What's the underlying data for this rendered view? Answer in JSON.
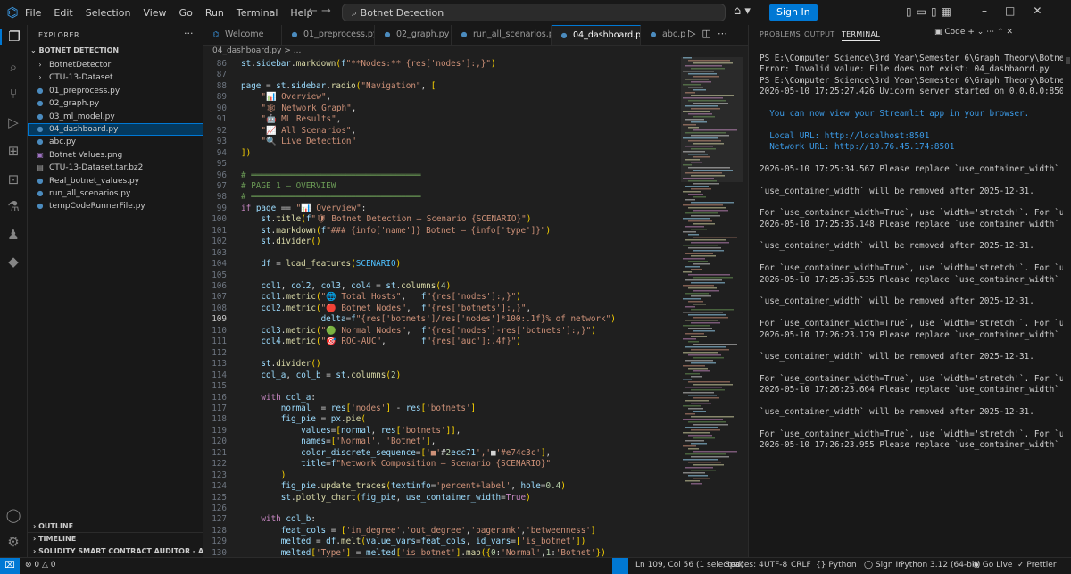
{
  "menu": [
    "File",
    "Edit",
    "Selection",
    "View",
    "Go",
    "Run",
    "Terminal",
    "Help"
  ],
  "titlebar": {
    "search_text": "Botnet Detection",
    "signin_label": "Sign In"
  },
  "sidebar": {
    "header": "EXPLORER",
    "project": "BOTNET DETECTION",
    "files": [
      {
        "name": "BotnetDetector",
        "icon": "folder-icon",
        "glyph": "›",
        "color": "#cccccc"
      },
      {
        "name": "CTU-13-Dataset",
        "icon": "folder-icon",
        "glyph": "›",
        "color": "#cccccc"
      },
      {
        "name": "01_preprocess.py",
        "icon": "python-file-icon",
        "glyph": "●",
        "color": "#4b8bbe"
      },
      {
        "name": "02_graph.py",
        "icon": "python-file-icon",
        "glyph": "●",
        "color": "#4b8bbe"
      },
      {
        "name": "03_ml_model.py",
        "icon": "python-file-icon",
        "glyph": "●",
        "color": "#4b8bbe"
      },
      {
        "name": "04_dashboard.py",
        "icon": "python-file-icon",
        "glyph": "●",
        "color": "#4b8bbe"
      },
      {
        "name": "abc.py",
        "icon": "python-file-icon",
        "glyph": "●",
        "color": "#4b8bbe"
      },
      {
        "name": "Botnet Values.png",
        "icon": "image-file-icon",
        "glyph": "▣",
        "color": "#a074c4"
      },
      {
        "name": "CTU-13-Dataset.tar.bz2",
        "icon": "archive-file-icon",
        "glyph": "▤",
        "color": "#a0a0a0"
      },
      {
        "name": "Real_botnet_values.py",
        "icon": "python-file-icon",
        "glyph": "●",
        "color": "#4b8bbe"
      },
      {
        "name": "run_all_scenarios.py",
        "icon": "python-file-icon",
        "glyph": "●",
        "color": "#4b8bbe"
      },
      {
        "name": "tempCodeRunnerFile.py",
        "icon": "python-file-icon",
        "glyph": "●",
        "color": "#4b8bbe"
      }
    ],
    "bottom": [
      "OUTLINE",
      "TIMELINE",
      "SOLIDITY SMART CONTRACT AUDITOR - ARMUR AI"
    ]
  },
  "editor": {
    "tabs": [
      "Welcome",
      "01_preprocess.py",
      "02_graph.py",
      "run_all_scenarios.py",
      "04_dashboard.py",
      "abc.py"
    ],
    "breadcrumb": "04_dashboard.py > ...",
    "lines": [
      {
        "n": "86",
        "t": "st.sidebar.markdown(f\"**Nodes:** {res['nodes']:,}\")"
      },
      {
        "n": "87",
        "t": ""
      },
      {
        "n": "88",
        "t": "page = st.sidebar.radio(\"Navigation\", ["
      },
      {
        "n": "89",
        "t": "    \"📊 Overview\","
      },
      {
        "n": "90",
        "t": "    \"🕸 Network Graph\","
      },
      {
        "n": "91",
        "t": "    \"🤖 ML Results\","
      },
      {
        "n": "92",
        "t": "    \"📈 All Scenarios\","
      },
      {
        "n": "93",
        "t": "    \"🔍 Live Detection\""
      },
      {
        "n": "94",
        "t": "])"
      },
      {
        "n": "95",
        "t": ""
      },
      {
        "n": "96",
        "t": "# ══════════════════════════════════"
      },
      {
        "n": "97",
        "t": "# PAGE 1 — OVERVIEW"
      },
      {
        "n": "98",
        "t": "# ══════════════════════════════════"
      },
      {
        "n": "99",
        "t": "if page == \"📊 Overview\":"
      },
      {
        "n": "100",
        "t": "    st.title(f\"🛡 Botnet Detection — Scenario {SCENARIO}\")"
      },
      {
        "n": "101",
        "t": "    st.markdown(f\"### {info['name']} Botnet — {info['type']}\")"
      },
      {
        "n": "102",
        "t": "    st.divider()"
      },
      {
        "n": "103",
        "t": ""
      },
      {
        "n": "104",
        "t": "    df = load_features(SCENARIO)"
      },
      {
        "n": "105",
        "t": ""
      },
      {
        "n": "106",
        "t": "    col1, col2, col3, col4 = st.columns(4)"
      },
      {
        "n": "107",
        "t": "    col1.metric(\"🌐 Total Hosts\",   f\"{res['nodes']:,}\")"
      },
      {
        "n": "108",
        "t": "    col2.metric(\"🔴 Botnet Nodes\",  f\"{res['botnets']:,}\","
      },
      {
        "n": "109",
        "t": "                delta=f\"{res['botnets']/res['nodes']*100:.1f}% of network\")"
      },
      {
        "n": "110",
        "t": "    col3.metric(\"🟢 Normal Nodes\",  f\"{res['nodes']-res['botnets']:,}\")"
      },
      {
        "n": "111",
        "t": "    col4.metric(\"🎯 ROC-AUC\",       f\"{res['auc']:.4f}\")"
      },
      {
        "n": "112",
        "t": ""
      },
      {
        "n": "113",
        "t": "    st.divider()"
      },
      {
        "n": "114",
        "t": "    col_a, col_b = st.columns(2)"
      },
      {
        "n": "115",
        "t": ""
      },
      {
        "n": "116",
        "t": "    with col_a:"
      },
      {
        "n": "117",
        "t": "        normal  = res['nodes'] - res['botnets']"
      },
      {
        "n": "118",
        "t": "        fig_pie = px.pie("
      },
      {
        "n": "119",
        "t": "            values=[normal, res['botnets']],"
      },
      {
        "n": "120",
        "t": "            names=['Normal', 'Botnet'],"
      },
      {
        "n": "121",
        "t": "            color_discrete_sequence=['■'#2ecc71','■'#e74c3c'],"
      },
      {
        "n": "122",
        "t": "            title=f\"Network Composition — Scenario {SCENARIO}\""
      },
      {
        "n": "123",
        "t": "        )"
      },
      {
        "n": "124",
        "t": "        fig_pie.update_traces(textinfo='percent+label', hole=0.4)"
      },
      {
        "n": "125",
        "t": "        st.plotly_chart(fig_pie, use_container_width=True)"
      },
      {
        "n": "126",
        "t": ""
      },
      {
        "n": "127",
        "t": "    with col_b:"
      },
      {
        "n": "128",
        "t": "        feat_cols = ['in_degree','out_degree','pagerank','betweenness']"
      },
      {
        "n": "129",
        "t": "        melted = df.melt(value_vars=feat_cols, id_vars=['is_botnet'])"
      },
      {
        "n": "130",
        "t": "        melted['Type'] = melted['is_botnet'].map({0:'Normal',1:'Botnet'})"
      },
      {
        "n": "131",
        "t": "        fig_box = px.box("
      }
    ]
  },
  "panel": {
    "tabs": [
      "PROBLEMS",
      "OUTPUT",
      "TERMINAL"
    ],
    "code_label": "Code",
    "lines": [
      {
        "t": "PS E:\\Computer Science\\3rd Year\\Semester 6\\Graph Theory\\Botnet Detection> streamlit run 04_dashbaord.py",
        "c": "#cccccc"
      },
      {
        "t": "Error: Invalid value: File does not exist: 04_dashbaord.py",
        "c": "#cccccc"
      },
      {
        "t": "PS E:\\Computer Science\\3rd Year\\Semester 6\\Graph Theory\\Botnet Detection> streamlit run 04_dashboard.py",
        "c": "#cccccc"
      },
      {
        "t": "2026-05-10 17:25:27.426 Uvicorn server started on 0.0.0.0:8501",
        "c": "#cccccc"
      },
      {
        "t": "",
        "c": "#cccccc"
      },
      {
        "t": "  You can now view your Streamlit app in your browser.",
        "c": "#3b9be8"
      },
      {
        "t": "",
        "c": "#cccccc"
      },
      {
        "t": "  Local URL: http://localhost:8501",
        "c": "#3b9be8"
      },
      {
        "t": "  Network URL: http://10.76.45.174:8501",
        "c": "#3b9be8"
      },
      {
        "t": "",
        "c": "#cccccc"
      },
      {
        "t": "2026-05-10 17:25:34.567 Please replace `use_container_width` with `width`.",
        "c": "#cccccc"
      },
      {
        "t": "",
        "c": "#cccccc"
      },
      {
        "t": "`use_container_width` will be removed after 2025-12-31.",
        "c": "#cccccc"
      },
      {
        "t": "",
        "c": "#cccccc"
      },
      {
        "t": "For `use_container_width=True`, use `width='stretch'`. For `use_container_width=False`, use `width='content'`.",
        "c": "#cccccc"
      },
      {
        "t": "2026-05-10 17:25:35.148 Please replace `use_container_width` with `width`.",
        "c": "#cccccc"
      },
      {
        "t": "",
        "c": "#cccccc"
      },
      {
        "t": "`use_container_width` will be removed after 2025-12-31.",
        "c": "#cccccc"
      },
      {
        "t": "",
        "c": "#cccccc"
      },
      {
        "t": "For `use_container_width=True`, use `width='stretch'`. For `use_container_width=False`, use `width='content'`.",
        "c": "#cccccc"
      },
      {
        "t": "2026-05-10 17:25:35.535 Please replace `use_container_width` with `width`.",
        "c": "#cccccc"
      },
      {
        "t": "",
        "c": "#cccccc"
      },
      {
        "t": "`use_container_width` will be removed after 2025-12-31.",
        "c": "#cccccc"
      },
      {
        "t": "",
        "c": "#cccccc"
      },
      {
        "t": "For `use_container_width=True`, use `width='stretch'`. For `use_container_width=False`, use `width='content'`.",
        "c": "#cccccc"
      },
      {
        "t": "2026-05-10 17:26:23.179 Please replace `use_container_width` with `width`.",
        "c": "#cccccc"
      },
      {
        "t": "",
        "c": "#cccccc"
      },
      {
        "t": "`use_container_width` will be removed after 2025-12-31.",
        "c": "#cccccc"
      },
      {
        "t": "",
        "c": "#cccccc"
      },
      {
        "t": "For `use_container_width=True`, use `width='stretch'`. For `use_container_width=False`, use `width='content'`.",
        "c": "#cccccc"
      },
      {
        "t": "2026-05-10 17:26:23.664 Please replace `use_container_width` with `width`.",
        "c": "#cccccc"
      },
      {
        "t": "",
        "c": "#cccccc"
      },
      {
        "t": "`use_container_width` will be removed after 2025-12-31.",
        "c": "#cccccc"
      },
      {
        "t": "",
        "c": "#cccccc"
      },
      {
        "t": "For `use_container_width=True`, use `width='stretch'`. For `use_container_width=False`, use `width='content'`.",
        "c": "#cccccc"
      },
      {
        "t": "2026-05-10 17:26:23.955 Please replace `use_container_width` with `width`.",
        "c": "#cccccc"
      }
    ]
  },
  "status": {
    "position": "Ln 109, Col 56 (1 selected)",
    "spaces": "Spaces: 4",
    "encoding": "UTF-8",
    "eol": "CRLF",
    "language": "Python",
    "signin": "Sign In",
    "interpreter": "Python 3.12 (64-bit)",
    "golive": "Go Live",
    "prettier": "Prettier"
  },
  "colors": {
    "accent": "#0078d4",
    "keyword": "#c586c0",
    "string": "#ce9178",
    "comment": "#6a9955",
    "function": "#dcdcaa",
    "variable": "#9cdcfe",
    "number": "#b5cea8"
  }
}
